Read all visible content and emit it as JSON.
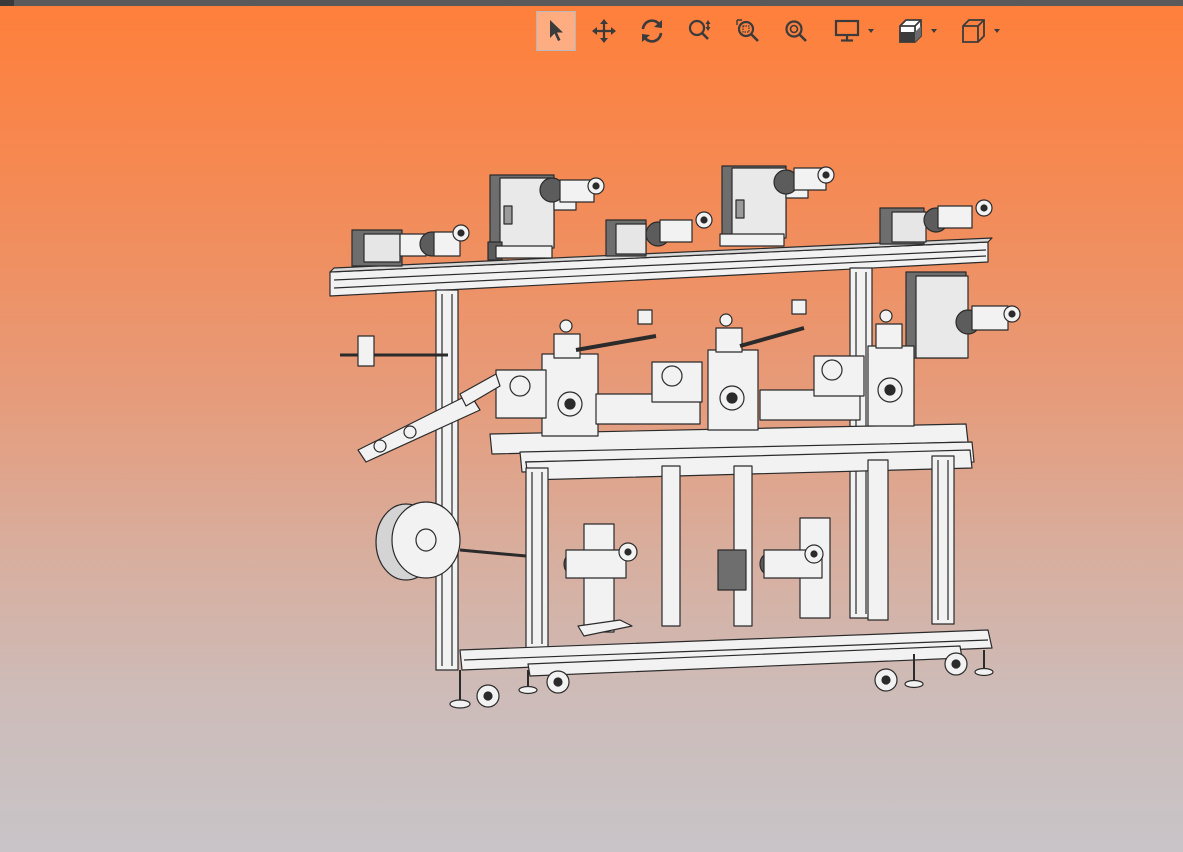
{
  "viewer": {
    "background_top": "#ff7f3a",
    "background_bottom": "#c8c4c8"
  },
  "toolbar": {
    "tools": [
      {
        "id": "select",
        "icon": "cursor-arrow-icon",
        "active": true
      },
      {
        "id": "pan",
        "icon": "move-arrows-icon",
        "active": false
      },
      {
        "id": "rotate",
        "icon": "rotate-icon",
        "active": false
      },
      {
        "id": "zoom",
        "icon": "zoom-icon",
        "active": false
      },
      {
        "id": "zoom-window",
        "icon": "zoom-window-icon",
        "active": false
      },
      {
        "id": "zoom-fit",
        "icon": "zoom-fit-icon",
        "active": false
      },
      {
        "id": "display-mode",
        "icon": "monitor-icon",
        "has_dropdown": true
      },
      {
        "id": "section-view",
        "icon": "section-cube-icon",
        "has_dropdown": true
      },
      {
        "id": "standard-views",
        "icon": "cube-icon",
        "has_dropdown": true
      }
    ]
  },
  "model": {
    "description_icon": "machine-assembly-model",
    "line_color": "#2b2b2b",
    "face_color": "#f2f2f2",
    "shade_color": "#6e6e6e"
  }
}
